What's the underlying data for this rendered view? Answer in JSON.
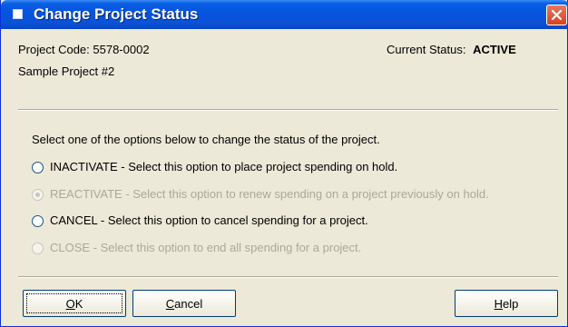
{
  "window": {
    "title": "Change Project Status"
  },
  "project": {
    "code_label": "Project Code:",
    "code": "5578-0002",
    "name": "Sample Project #2",
    "status_label": "Current Status:",
    "status": "ACTIVE"
  },
  "instruction": "Select one of the options below to change the status of the project.",
  "options": [
    {
      "name": "INACTIVATE",
      "desc": "Select this option to place project spending on hold.",
      "enabled": true,
      "selected": false
    },
    {
      "name": "REACTIVATE",
      "desc": "Select this option to renew spending on a project previously on hold.",
      "enabled": false,
      "selected": true
    },
    {
      "name": "CANCEL",
      "desc": "Select this option to cancel spending for a project.",
      "enabled": true,
      "selected": false
    },
    {
      "name": "CLOSE",
      "desc": "Select this option to end all spending for a project.",
      "enabled": false,
      "selected": false
    }
  ],
  "buttons": {
    "ok": {
      "mnemonic": "O",
      "rest": "K"
    },
    "cancel": {
      "mnemonic": "C",
      "rest": "ancel"
    },
    "help": {
      "mnemonic": "H",
      "rest": "elp"
    }
  },
  "colors": {
    "titlebar": "#0554e0",
    "disabled_text": "#aca899",
    "close_button": "#d6431f"
  }
}
